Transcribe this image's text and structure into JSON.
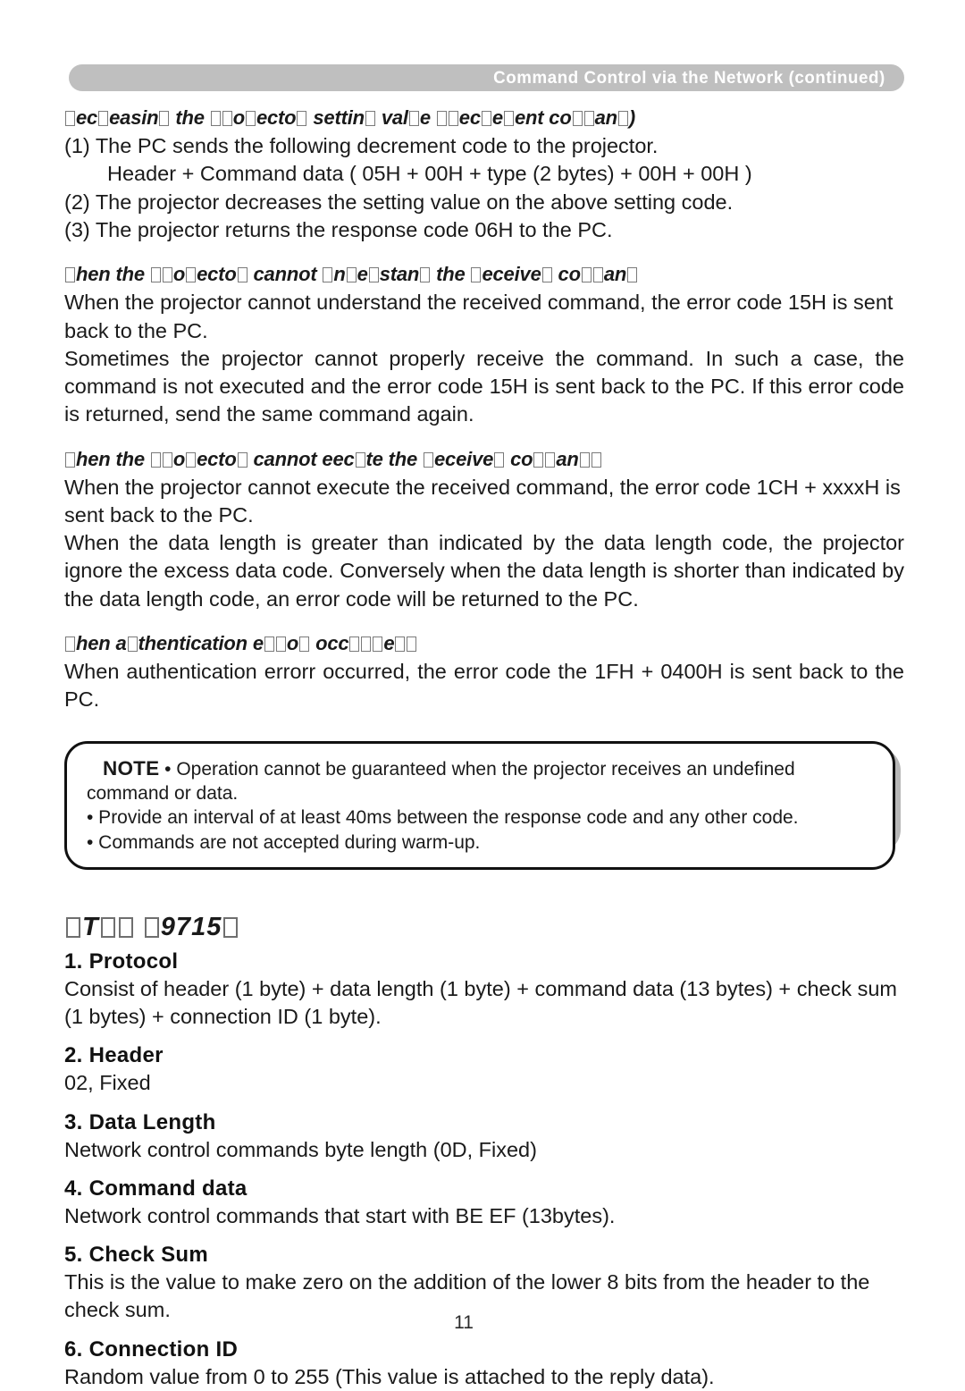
{
  "header": {
    "running_title": "Command Control via the Network (continued)"
  },
  "sections": {
    "decrement": {
      "heading_parts": [
        "□",
        "ec",
        "□",
        "easin",
        "□",
        " the ",
        "□",
        "□",
        "o",
        "□",
        "ecto",
        "□",
        " settin",
        "□",
        " val",
        "□",
        "e ",
        "□",
        "□",
        "ec",
        "□",
        "e",
        "□",
        "ent co",
        "□",
        "□",
        "an",
        "□",
        ")"
      ],
      "heading_text": "□ec□easin□ the □□o□ecto□ settin□ val□e □□ec□e□ent co□□an□)",
      "line1": "(1) The PC sends the following decrement code to the projector.",
      "line2": "Header + Command data ( 05H  +  00H  + type (2 bytes) +  00H  +  00H )",
      "line3": "(2) The projector decreases the setting value on the above setting code.",
      "line4": "(3) The projector returns the response code  06H  to the PC."
    },
    "cannot_understand": {
      "heading_text": "□hen the □□o□ecto□ cannot □n□e□stan□ the □eceive□ co□□an□",
      "para1": "When the projector cannot understand the received command, the error code  15H  is sent back to the PC.",
      "para2": "Sometimes the projector cannot properly receive the command. In such a case, the command is not executed and the error code  15H  is sent back to the PC. If this error code is returned, send the same command again."
    },
    "cannot_execute": {
      "heading_text": "□hen the □□o□ecto□ cannot eec□te the □eceive□ co□□an□□",
      "para1": "When the projector cannot execute the received command, the error code  1CH  +  xxxxH  is sent back to the PC.",
      "para2": "When the data length is greater than indicated by the data length code, the projector ignore the excess data code. Conversely when the data length is shorter than indicated by the data length code, an error code will be returned to the PC."
    },
    "auth_error": {
      "heading_text": "□hen a□thentication e□□o□ occ□□□e□□",
      "para1": "When authentication errorr occurred, the error code the  1FH  +  0400H  is sent back to the PC."
    }
  },
  "note": {
    "label": "NOTE",
    "bullet1": "• Operation cannot be guaranteed when the projector receives an undefined command or data.",
    "bullet2": "• Provide an interval of at least 40ms between the response code and any other code.",
    "bullet3": "• Commands are not accepted during warm-up."
  },
  "protocol_section": {
    "title_text": "□T□□ □9715□",
    "items": [
      {
        "heading": "1. Protocol",
        "body": "Consist of header (1 byte) + data length (1 byte) + command data (13 bytes) + check sum (1 bytes) + connection ID (1 byte)."
      },
      {
        "heading": "2. Header",
        "body": "02, Fixed"
      },
      {
        "heading": "3. Data Length",
        "body": "Network control commands byte length (0D, Fixed)"
      },
      {
        "heading": "4. Command data",
        "body": "Network control commands that start with BE EF (13bytes)."
      },
      {
        "heading": "5. Check Sum",
        "body": "This is the value to make zero on the addition of the lower 8 bits from the header to the check sum."
      },
      {
        "heading": "6. Connection ID",
        "body": "Random value from 0 to 255 (This value is attached to the reply data)."
      }
    ]
  },
  "footer": {
    "page_number": "11"
  }
}
